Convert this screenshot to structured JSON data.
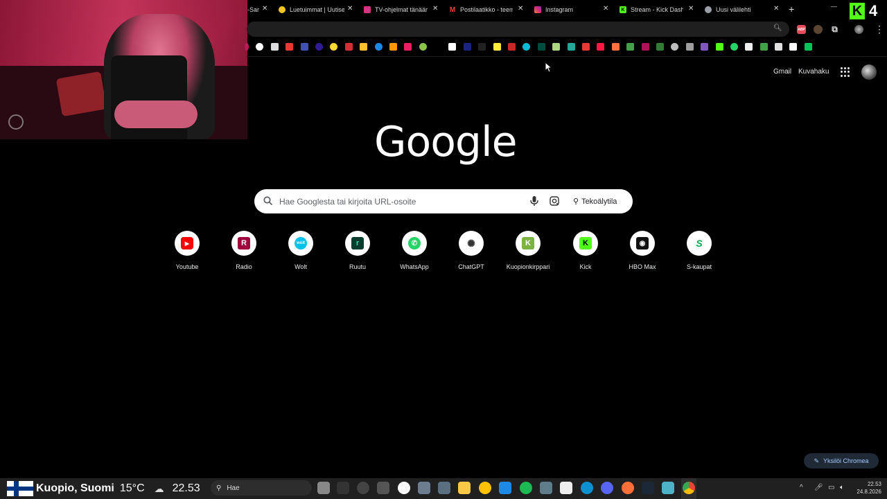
{
  "tabs": [
    {
      "title": "-Sar",
      "icon_color": "#777"
    },
    {
      "title": "Luetuimmat | Uutiset",
      "icon_color": "#f5c518"
    },
    {
      "title": "TV-ohjelmat tänään |",
      "icon_color": "#d63384"
    },
    {
      "title": "Postilaatikko - teemu",
      "icon_color": "#ea4335"
    },
    {
      "title": "Instagram",
      "icon_color": "#e1306c"
    },
    {
      "title": "Stream - Kick Dashbo",
      "icon_color": "#53fc18"
    },
    {
      "title": "Uusi välilehti",
      "icon_color": "#9aa0a6"
    }
  ],
  "tab_close": "✕",
  "new_tab": "+",
  "window_controls": {
    "minimize": "—",
    "maximize": "☐"
  },
  "kick_corner": {
    "logo": "K",
    "number": "4"
  },
  "header_links": {
    "gmail": "Gmail",
    "images": "Kuvahaku"
  },
  "logo": "Google",
  "search": {
    "placeholder": "Hae Googlesta tai kirjoita URL-osoite",
    "ai_mode": "Tekoälytila"
  },
  "shortcuts": [
    {
      "label": "Youtube",
      "icon": "youtube-icon",
      "color": "#ff0000",
      "glyph": "▶"
    },
    {
      "label": "Radio",
      "icon": "radio-icon",
      "color": "#a0003c",
      "glyph": "R"
    },
    {
      "label": "Wolt",
      "icon": "wolt-icon",
      "color": "#00c2e8",
      "glyph": "w"
    },
    {
      "label": "Ruutu",
      "icon": "ruutu-icon",
      "color": "#0b3d2e",
      "glyph": "r"
    },
    {
      "label": "WhatsApp",
      "icon": "whatsapp-icon",
      "color": "#25d366",
      "glyph": "✆"
    },
    {
      "label": "ChatGPT",
      "icon": "chatgpt-icon",
      "color": "#ffffff",
      "glyph": "✺"
    },
    {
      "label": "Kuopionkirppari",
      "icon": "kuopionkirppari-icon",
      "color": "#7cb342",
      "glyph": "K"
    },
    {
      "label": "Kick",
      "icon": "kick-icon",
      "color": "#53fc18",
      "glyph": "K"
    },
    {
      "label": "HBO Max",
      "icon": "hbomax-icon",
      "color": "#111111",
      "glyph": "◉"
    },
    {
      "label": "S-kaupat",
      "icon": "skaupat-icon",
      "color": "#ffffff",
      "glyph": "S"
    }
  ],
  "customize": {
    "label": "Yksilöi Chromea",
    "icon": "pen-icon"
  },
  "taskbar": {
    "weather": "Kuopio, Suomi",
    "temp": "15°C",
    "overlay_clock": "22.53",
    "search_label": "Hae",
    "time": "22.53",
    "date": "24.8.2026"
  },
  "colors": {
    "accent": "#a8c7fa",
    "background": "#000000",
    "kick_green": "#53fc18"
  }
}
